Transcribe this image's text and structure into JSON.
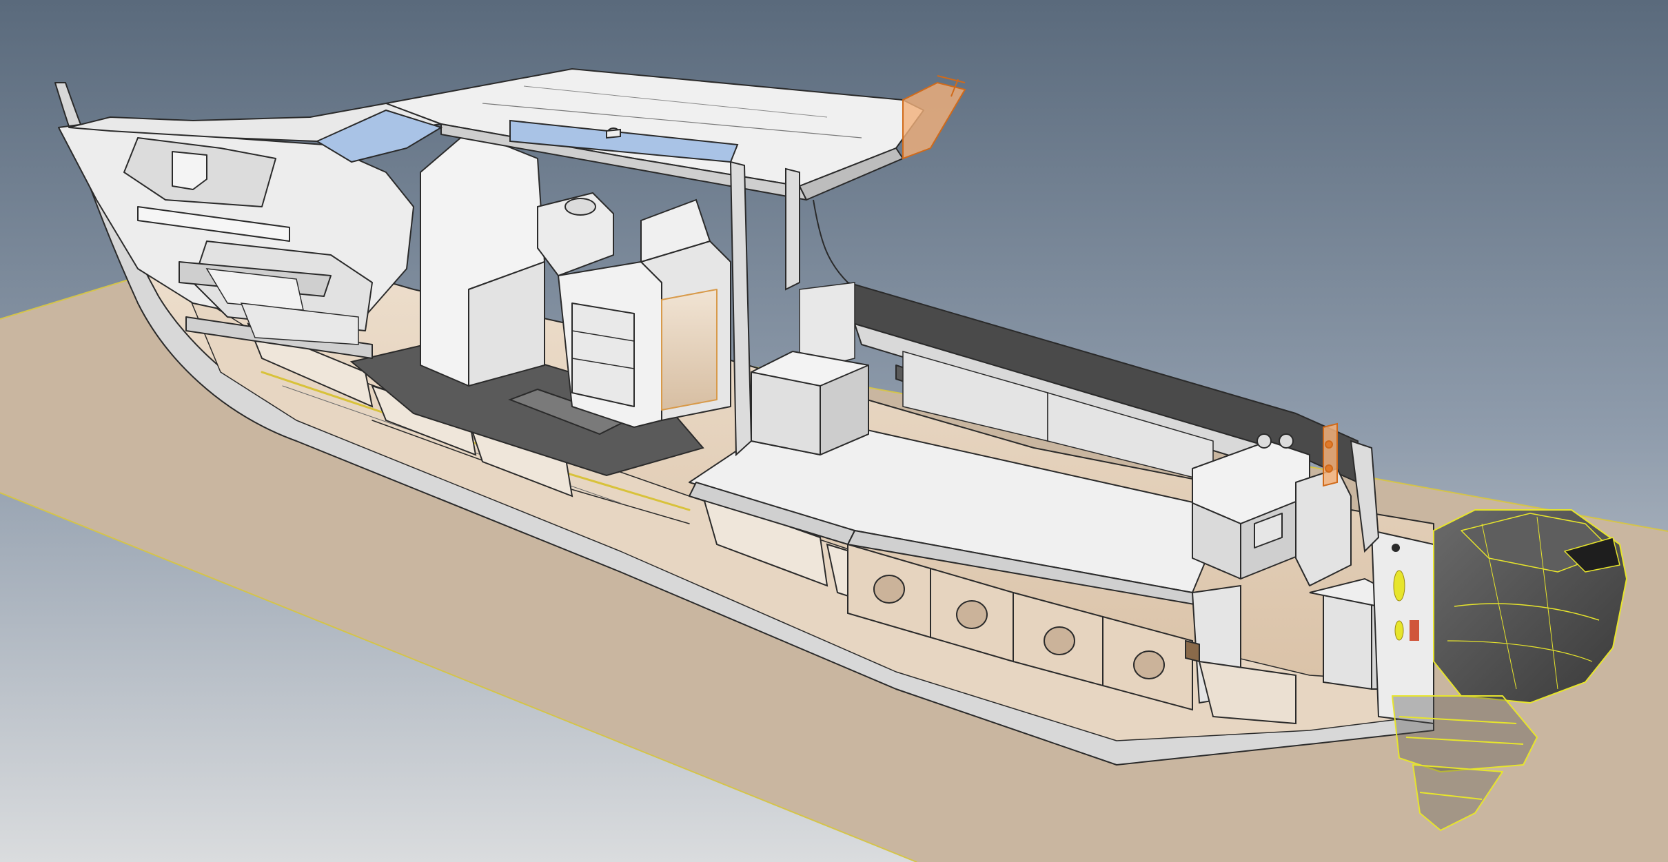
{
  "viewport": {
    "background": {
      "top": "#5a6a7c",
      "middle": "#8f9cac",
      "bottom": "#dadcde"
    },
    "ground_plane": {
      "fill": "#c9b6a0",
      "edge": "#d4c44a"
    }
  },
  "colors": {
    "hull_white": "#eeeeee",
    "hull_shadow": "#c9c9c9",
    "edge_line": "#2a2a2a",
    "deck_dark": "#5a5a5a",
    "gunwale_dark": "#4a4a4a",
    "interior_tan": "#e8d5bf",
    "window_glass": "#a9c3e6",
    "engine_body": "#4d4d4d",
    "selection_yellow": "#e7e52c",
    "highlight_orange": "#f29a4a"
  },
  "scene_parts": [
    "ground-plane",
    "boat-shadow",
    "hull",
    "bow-cabin",
    "hardtop-roof",
    "windshield",
    "helm-console",
    "galley-cabinet",
    "cockpit-deck",
    "gunwale-rail",
    "hull-stringers",
    "inspection-hatches",
    "transom-locker",
    "outboard-motor",
    "outboard-leg"
  ]
}
